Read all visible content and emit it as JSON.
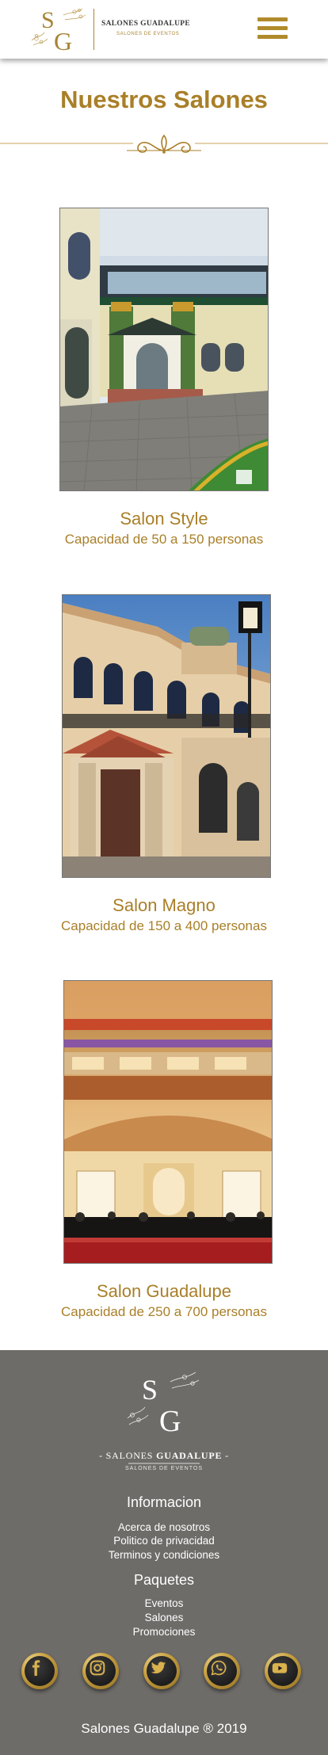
{
  "header": {
    "brand_name": "SALONES GUADALUPE",
    "brand_tagline": "SALONES DE EVENTOS",
    "monogram_s": "S",
    "monogram_g": "G"
  },
  "page": {
    "title": "Nuestros Salones"
  },
  "salons": [
    {
      "name": "Salon Style",
      "capacity": "Capacidad de 50 a 150 personas"
    },
    {
      "name": "Salon Magno",
      "capacity": "Capacidad de 150 a 400 personas"
    },
    {
      "name": "Salon Guadalupe",
      "capacity": "Capacidad de 250 a 700 personas"
    }
  ],
  "footer": {
    "brand_prefix": "- SALONES ",
    "brand_bold": "GUADALUPE",
    "brand_suffix": " -",
    "tagline": "SALONES DE EVENTOS",
    "info_heading": "Informacion",
    "info_links": [
      "Acerca de nosotros",
      "Politico de privacidad",
      "Terminos y condiciones"
    ],
    "packages_heading": "Paquetes",
    "package_links": [
      "Eventos",
      "Salones",
      "Promociones"
    ],
    "social": [
      "facebook-icon",
      "instagram-icon",
      "twitter-icon",
      "whatsapp-icon",
      "youtube-icon"
    ],
    "copyright": "Salones Guadalupe ® 2019"
  },
  "colors": {
    "accent": "#a97f28",
    "footer_bg": "#6e6c69",
    "gold": "#c9a243"
  }
}
